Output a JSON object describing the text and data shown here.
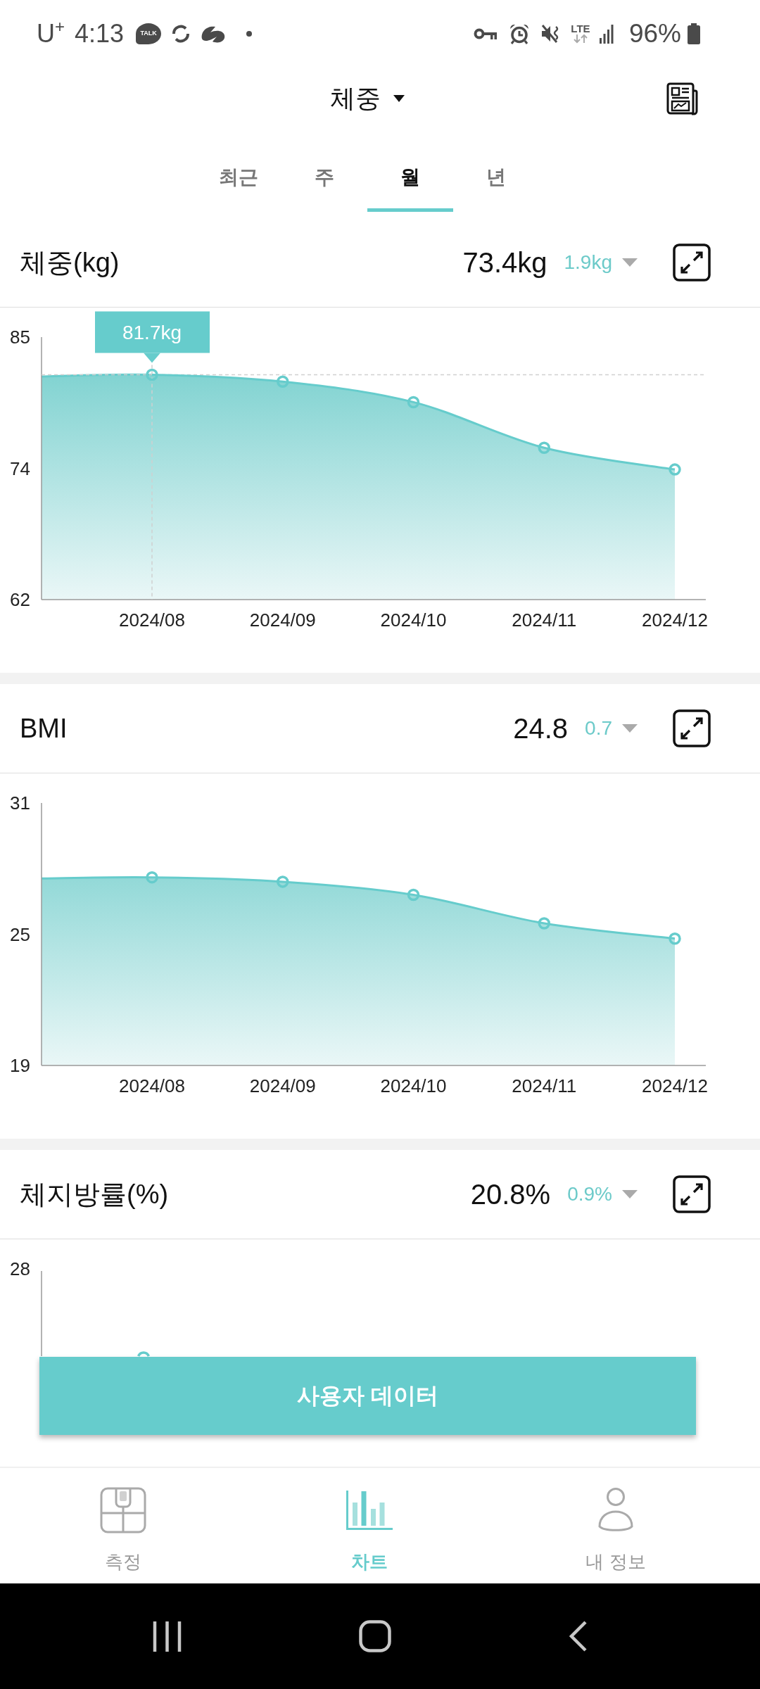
{
  "status_bar": {
    "carrier": "U$^{+}$",
    "time": "4:13",
    "chat_icon_text": "TALK",
    "network": "LTE",
    "battery": "96%"
  },
  "header": {
    "title": "체중"
  },
  "period_tabs": [
    {
      "label": "최근",
      "selected": false
    },
    {
      "label": "주",
      "selected": false
    },
    {
      "label": "월",
      "selected": true
    },
    {
      "label": "년",
      "selected": false
    }
  ],
  "cards": [
    {
      "title": "체중(kg)",
      "value": "73.4kg",
      "change": "1.9kg",
      "decreasing": true,
      "chart_data": {
        "type": "area",
        "categories": [
          "2024/08",
          "2024/09",
          "2024/10",
          "2024/11",
          "2024/12"
        ],
        "values": [
          81.7,
          81.1,
          79.3,
          75.3,
          73.4
        ],
        "ylim": [
          62,
          85
        ],
        "yticks": [
          62,
          {
            "value": 73.5,
            "label": "74"
          },
          85
        ],
        "annotations": [
          "81.7kg"
        ]
      }
    },
    {
      "title": "BMI",
      "value": "24.8",
      "change": "0.7",
      "decreasing": true,
      "chart_data": {
        "type": "area",
        "categories": [
          "2024/08",
          "2024/09",
          "2024/10",
          "2024/11",
          "2024/12"
        ],
        "values": [
          27.6,
          27.4,
          26.8,
          25.5,
          24.8
        ],
        "ylim": [
          19,
          31
        ],
        "yticks": [
          19,
          25,
          31
        ]
      }
    },
    {
      "title": "체지방률(%)",
      "value": "20.8%",
      "change": "0.9%",
      "decreasing": true,
      "y_tick_labels": [
        "28"
      ]
    }
  ],
  "action_button": {
    "label": "사용자 데이터"
  },
  "bottom_nav": [
    {
      "label": "측정",
      "selected": false
    },
    {
      "label": "차트",
      "selected": true
    },
    {
      "label": "내 정보",
      "selected": false
    }
  ]
}
